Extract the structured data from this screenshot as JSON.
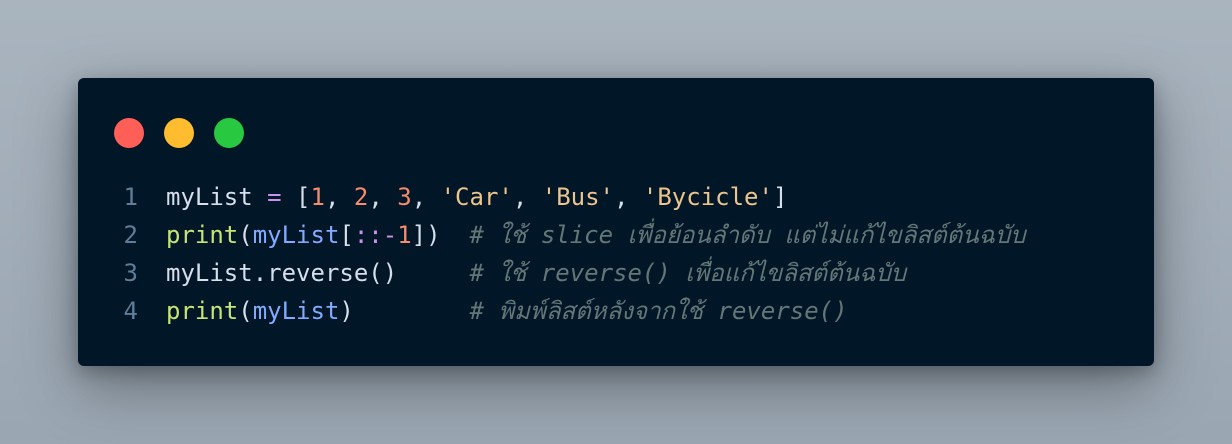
{
  "window": {
    "controls": [
      {
        "name": "close",
        "color": "#ff5f57"
      },
      {
        "name": "minimize",
        "color": "#febc2e"
      },
      {
        "name": "maximize",
        "color": "#28c840"
      }
    ]
  },
  "code": {
    "lines": [
      {
        "number": "1",
        "tokens": [
          {
            "t": "myList",
            "k": "var"
          },
          {
            "t": " ",
            "k": "punc"
          },
          {
            "t": "=",
            "k": "op"
          },
          {
            "t": " [",
            "k": "punc"
          },
          {
            "t": "1",
            "k": "num"
          },
          {
            "t": ", ",
            "k": "punc"
          },
          {
            "t": "2",
            "k": "num"
          },
          {
            "t": ", ",
            "k": "punc"
          },
          {
            "t": "3",
            "k": "num"
          },
          {
            "t": ", ",
            "k": "punc"
          },
          {
            "t": "'Car'",
            "k": "str"
          },
          {
            "t": ", ",
            "k": "punc"
          },
          {
            "t": "'Bus'",
            "k": "str"
          },
          {
            "t": ", ",
            "k": "punc"
          },
          {
            "t": "'Bycicle'",
            "k": "str"
          },
          {
            "t": "]",
            "k": "punc"
          }
        ]
      },
      {
        "number": "2",
        "tokens": [
          {
            "t": "print",
            "k": "fn"
          },
          {
            "t": "(",
            "k": "punc"
          },
          {
            "t": "myList",
            "k": "arg"
          },
          {
            "t": "[",
            "k": "punc"
          },
          {
            "t": "::",
            "k": "op"
          },
          {
            "t": "-",
            "k": "op"
          },
          {
            "t": "1",
            "k": "num"
          },
          {
            "t": "])  ",
            "k": "punc"
          },
          {
            "t": "# ใช้ slice เพื่อย้อนลำดับ แต่ไม่แก้ไขลิสต์ต้นฉบับ",
            "k": "cmt"
          }
        ]
      },
      {
        "number": "3",
        "tokens": [
          {
            "t": "myList.reverse()",
            "k": "var"
          },
          {
            "t": "     ",
            "k": "punc"
          },
          {
            "t": "# ใช้ reverse() เพื่อแก้ไขลิสต์ต้นฉบับ",
            "k": "cmt"
          }
        ]
      },
      {
        "number": "4",
        "tokens": [
          {
            "t": "print",
            "k": "fn"
          },
          {
            "t": "(",
            "k": "punc"
          },
          {
            "t": "myList",
            "k": "arg"
          },
          {
            "t": ")",
            "k": "punc"
          },
          {
            "t": "        ",
            "k": "punc"
          },
          {
            "t": "# พิมพ์ลิสต์หลังจากใช้ reverse()",
            "k": "cmt"
          }
        ]
      }
    ]
  }
}
